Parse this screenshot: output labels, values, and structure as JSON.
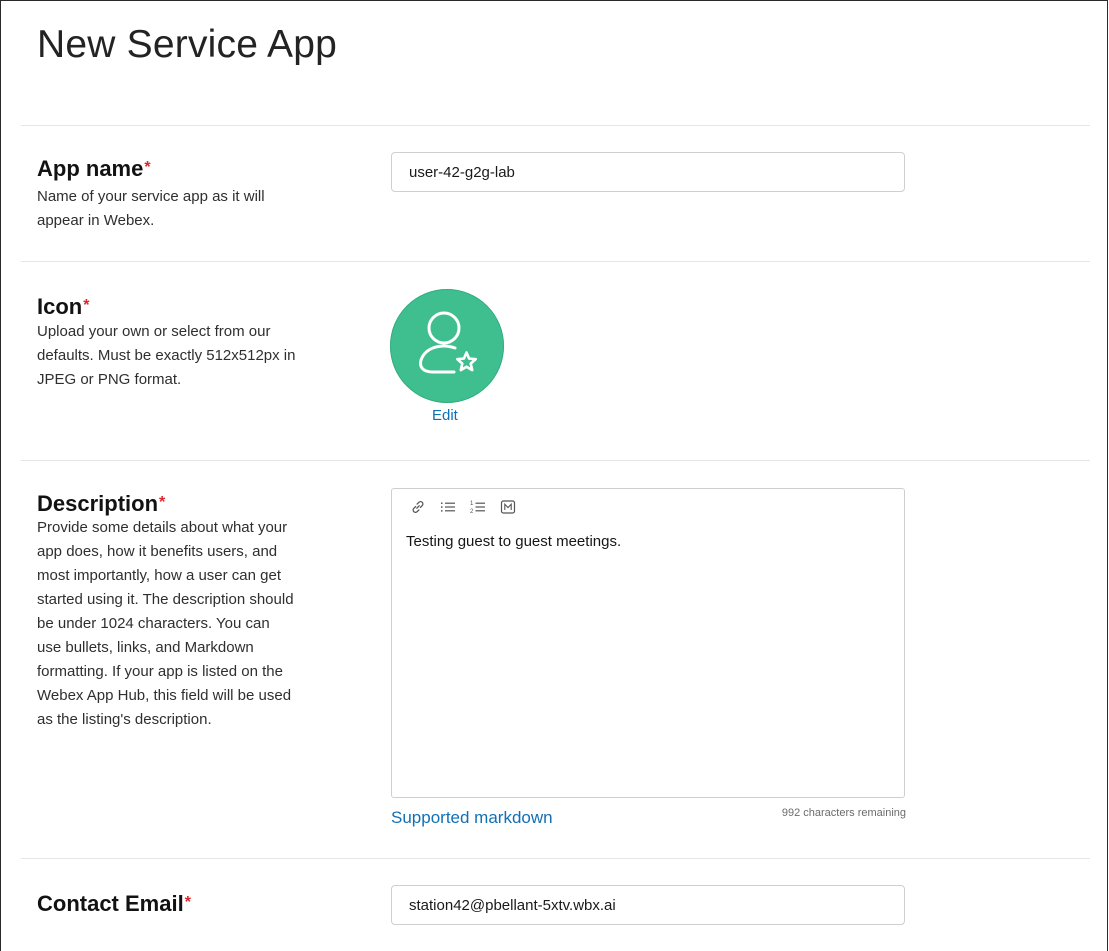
{
  "page": {
    "title": "New Service App"
  },
  "required_marker": "*",
  "app_name": {
    "label": "App name",
    "help": "Name of your service app as it will appear in Webex.",
    "value": "user-42-g2g-lab"
  },
  "icon": {
    "label": "Icon",
    "help": "Upload your own or select from our defaults. Must be exactly 512x512px in JPEG or PNG format.",
    "edit_label": "Edit",
    "icon_name": "user-gear-icon",
    "background_color": "#3fbf8f"
  },
  "description": {
    "label": "Description",
    "help": "Provide some details about what your app does, how it benefits users, and most importantly, how a user can get started using it. The description should be under 1024 characters. You can use bullets, links, and Markdown formatting. If your app is listed on the Webex App Hub, this field will be used as the listing's description.",
    "toolbar": [
      "link-icon",
      "bulleted-list-icon",
      "numbered-list-icon",
      "markdown-icon"
    ],
    "value": "Testing guest to guest meetings.",
    "supported_markdown_label": "Supported markdown",
    "chars_remaining": "992 characters remaining"
  },
  "contact_email": {
    "label": "Contact Email",
    "value": "station42@pbellant-5xtv.wbx.ai"
  },
  "colors": {
    "link": "#1170b5",
    "required": "#e0242b",
    "icon_green": "#3fbf8f"
  }
}
